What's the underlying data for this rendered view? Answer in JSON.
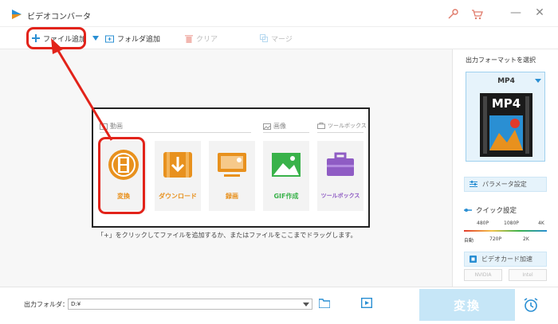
{
  "window": {
    "title": "ビデオコンバータ",
    "minimize": "—",
    "close": "✕"
  },
  "toolbar": {
    "add_file": "ファイル追加",
    "add_folder": "フォルダ追加",
    "clear": "クリア",
    "merge": "マージ"
  },
  "main": {
    "sections": {
      "video": "動画",
      "image": "画像",
      "toolbox": "ツールボックス"
    },
    "tiles": [
      {
        "label": "変換",
        "icon": "film-convert-icon"
      },
      {
        "label": "ダウンロード",
        "icon": "download-icon"
      },
      {
        "label": "録画",
        "icon": "screen-record-icon"
      },
      {
        "label": "GIF作成",
        "icon": "gif-image-icon"
      },
      {
        "label": "ツールボックス",
        "icon": "toolbox-icon"
      }
    ],
    "hint": "「+」をクリックしてファイルを追加するか、またはファイルをここまでドラッグします。"
  },
  "sidebar": {
    "title": "出力フォーマットを選択",
    "format": "MP4",
    "format_badge": "MP4",
    "param_button": "パラメータ設定",
    "quick_title": "クイック設定",
    "quick_top": [
      "480P",
      "1080P",
      "4K"
    ],
    "quick_bottom": [
      "自動",
      "720P",
      "2K"
    ],
    "gpu_button": "ビデオカード加速",
    "hw": [
      "NVIDIA",
      "Intel"
    ]
  },
  "bottom": {
    "output_label": "出力フォルダ：",
    "output_path": "D:¥",
    "convert": "変換"
  },
  "colors": {
    "accent": "#2a8fd3",
    "highlight": "#e2231a",
    "orange": "#e8911e",
    "green": "#39b24a",
    "purple": "#8f5cc4"
  }
}
